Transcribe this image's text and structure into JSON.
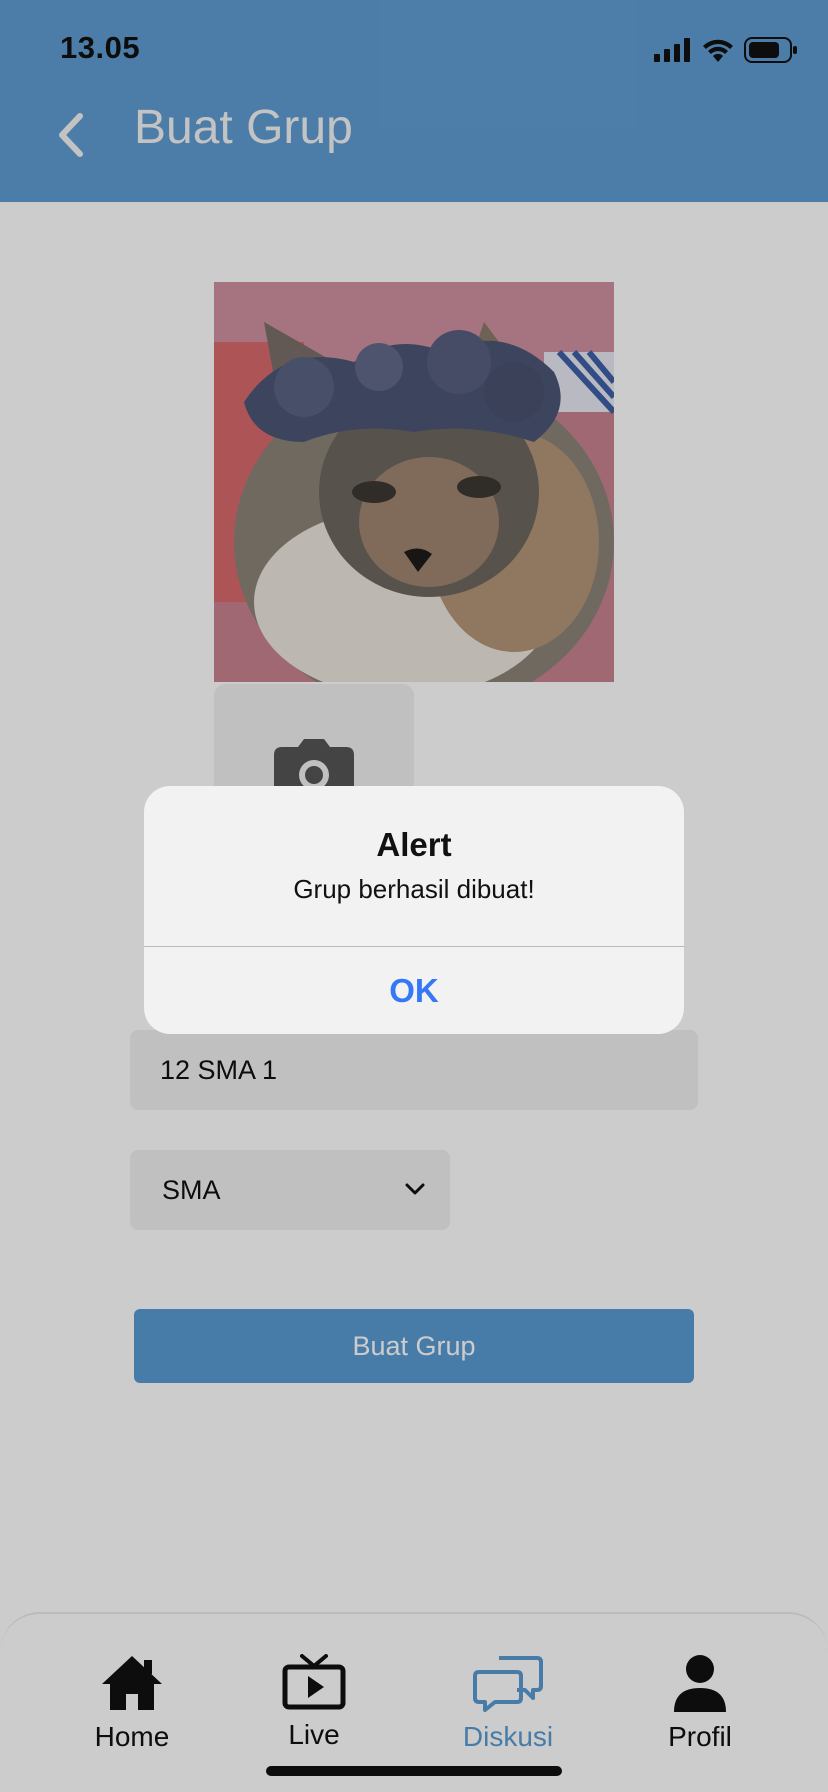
{
  "status_bar": {
    "time": "13.05"
  },
  "header": {
    "title": "Buat Grup"
  },
  "form": {
    "group_name_value": "12 SMA 1",
    "level_selected": "SMA",
    "submit_label": "Buat Grup"
  },
  "alert": {
    "title": "Alert",
    "message": "Grup berhasil dibuat!",
    "ok_label": "OK"
  },
  "tabbar": {
    "items": [
      {
        "label": "Home",
        "icon": "home-icon"
      },
      {
        "label": "Live",
        "icon": "tv-icon"
      },
      {
        "label": "Diskusi",
        "icon": "chat-icon",
        "active": true
      },
      {
        "label": "Profil",
        "icon": "person-icon"
      }
    ]
  },
  "colors": {
    "header": "#5f9dd3",
    "accent": "#5a9bd3",
    "alert_button": "#3478f6"
  }
}
